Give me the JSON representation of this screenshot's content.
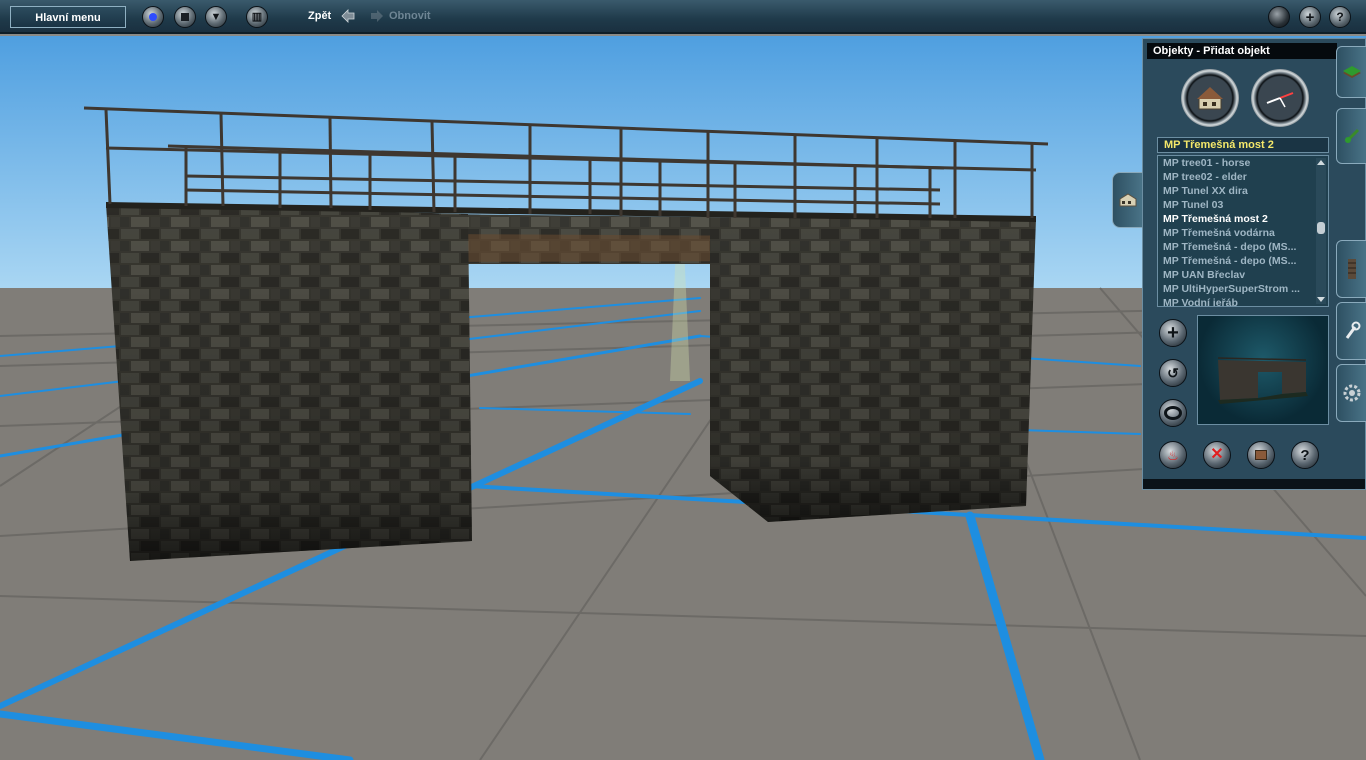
{
  "toolbar": {
    "main_menu_label": "Hlavní menu",
    "undo_label": "Zpět",
    "redo_label": "Obnovit"
  },
  "panel": {
    "title": "Objekty - Přidat objekt",
    "selected_object": "MP Třemešná most 2",
    "objects": [
      "MP tree01 - horse",
      "MP tree02 - elder",
      "MP Tunel XX dira",
      "MP Tunel 03",
      "MP Třemešná most 2",
      "MP Třemešná vodárna",
      "MP Třemešná - depo (MS...",
      "MP Třemešná - depo (MS...",
      "MP UAN Břeclav",
      "MP UltiHyperSuperStrom ...",
      "MP Vodní jeřáb"
    ],
    "active_index": 4
  },
  "colors": {
    "panel_bg": "#2b4a5c",
    "toolbar_bg": "#1f3a4a",
    "sky": "#6fb4e6",
    "ground": "#807d78",
    "grid_line": "#1e8ee0",
    "selected_text": "#f4e86a"
  },
  "icons": {
    "toolbar": [
      "blue-dot-icon",
      "stop-icon",
      "filter-icon",
      "trash-icon",
      "undo-arrow-icon",
      "redo-arrow-icon",
      "dark-round-icon",
      "plus-icon",
      "help-icon"
    ],
    "panel": [
      "house-dial-icon",
      "clock-dial-icon",
      "add-icon",
      "rotate-icon",
      "ring-icon",
      "flame-icon",
      "delete-icon",
      "object-icon",
      "help-icon"
    ],
    "tabs": [
      "terrain-tab-icon",
      "paint-tab-icon",
      "track-tab-icon",
      "wrench-tab-icon",
      "gear-tab-icon"
    ]
  }
}
